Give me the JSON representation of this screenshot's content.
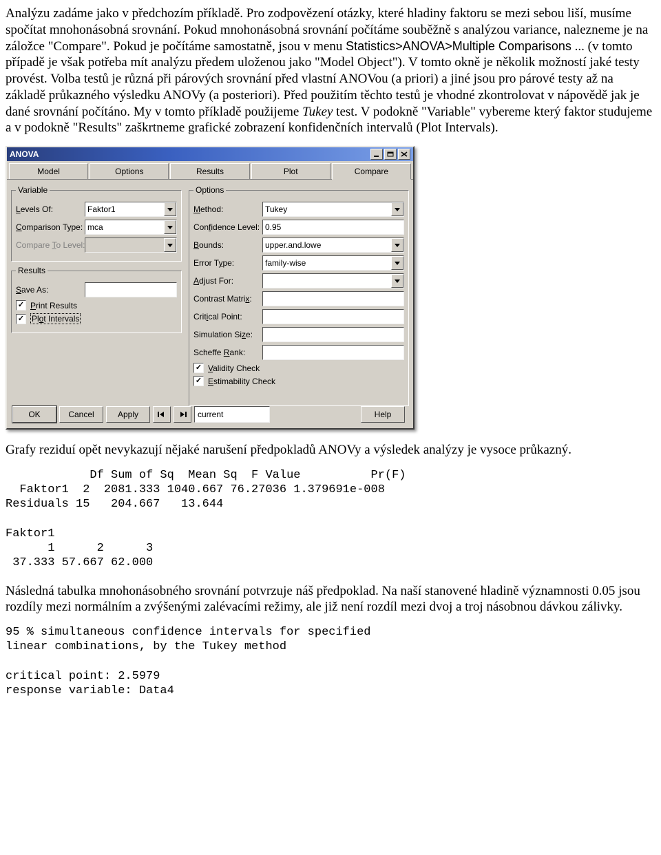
{
  "para1": "Analýzu zadáme jako v předchozím příkladě. Pro zodpovězení otázky, které hladiny faktoru se mezi sebou liší, musíme spočítat mnohonásobná srovnání. Pokud mnohonásobná srovnání počítáme souběžně s analýzou variance, nalezneme je na záložce \"Compare\". Pokud je počítáme samostatně, jsou v menu ",
  "menupath": "Statistics>ANOVA>Multiple Comparisons",
  "para1_after": "... (v tomto případě je však potřeba mít analýzu předem uloženou jako \"Model Object\"). V tomto okně je několik možností jaké testy provést. Volba testů je různá při párových srovnání před vlastní ANOVou (a priori) a jiné jsou pro párové testy až na základě průkazného výsledku ANOVy (a posteriori). Před použitím těchto testů je vhodné zkontrolovat v nápovědě jak je dané srovnání počítáno. My v tomto příkladě použijeme ",
  "testname": "Tukey",
  "para1_end": " test. V podokně \"Variable\" vybereme který faktor studujeme a v podokně \"Results\" zaškrtneme grafické zobrazení konfidenčních intervalů (Plot Intervals).",
  "dialog": {
    "title": "ANOVA",
    "tabs": [
      "Model",
      "Options",
      "Results",
      "Plot",
      "Compare"
    ],
    "variable": {
      "legend": "Variable",
      "levels_label": "Levels Of:",
      "levels_value": "Faktor1",
      "comptype_label": "Comparison Type:",
      "comptype_value": "mca",
      "compto_label": "Compare To Level:"
    },
    "results": {
      "legend": "Results",
      "saveas_label": "Save As:",
      "print_label": "Print Results",
      "plot_label": "Plot Intervals"
    },
    "options": {
      "legend": "Options",
      "method_label": "Method:",
      "method_value": "Tukey",
      "conflevel_label": "Confidence Level:",
      "conflevel_value": "0.95",
      "bounds_label": "Bounds:",
      "bounds_value": "upper.and.lowe",
      "errortype_label": "Error Type:",
      "errortype_value": "family-wise",
      "adjust_label": "Adjust For:",
      "contrast_label": "Contrast Matrix:",
      "critpt_label": "Critical Point:",
      "simsize_label": "Simulation Size:",
      "scheffe_label": "Scheffe Rank:",
      "validity_label": "Validity Check",
      "estimability_label": "Estimability Check"
    },
    "buttons": {
      "ok": "OK",
      "cancel": "Cancel",
      "apply": "Apply",
      "prev": "|◁",
      "next": "▷|",
      "current": "current",
      "help": "Help"
    }
  },
  "para2": "Grafy reziduí opět nevykazují nějaké narušení předpokladů ANOVy a výsledek analýzy je vysoce průkazný.",
  "code1": "            Df Sum of Sq  Mean Sq  F Value          Pr(F)\n  Faktor1  2  2081.333 1040.667 76.27036 1.379691e-008\nResiduals 15   204.667   13.644\n\nFaktor1\n      1      2      3\n 37.333 57.667 62.000",
  "para3": "Následná tabulka mnohonásobného srovnání potvrzuje náš předpoklad. Na naší stanovené hladině významnosti 0.05 jsou rozdíly mezi normálním a zvýšenými zalévacími režimy, ale již není rozdíl mezi dvoj a troj násobnou dávkou zálivky.",
  "code2": "95 % simultaneous confidence intervals for specified\nlinear combinations, by the Tukey method\n\ncritical point: 2.5979\nresponse variable: Data4"
}
